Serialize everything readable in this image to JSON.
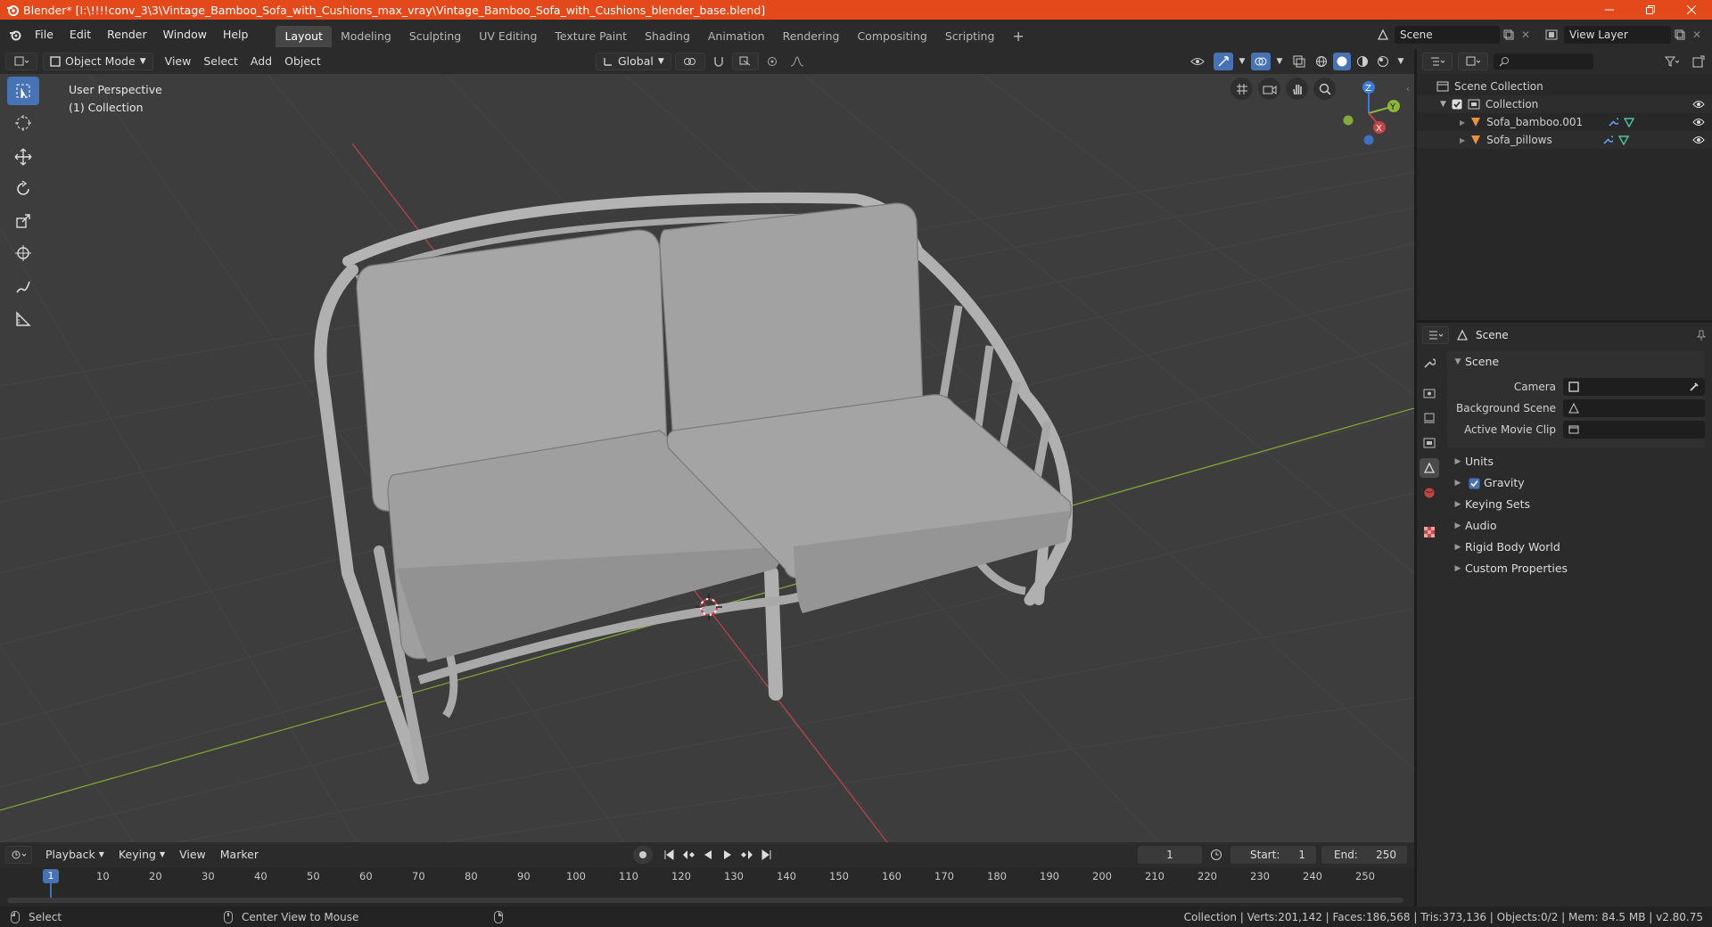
{
  "window": {
    "title": "Blender* [I:\\!!!!conv_3\\3\\Vintage_Bamboo_Sofa_with_Cushions_max_vray\\Vintage_Bamboo_Sofa_with_Cushions_blender_base.blend]"
  },
  "menus": [
    "File",
    "Edit",
    "Render",
    "Window",
    "Help"
  ],
  "workspaces": [
    "Layout",
    "Modeling",
    "Sculpting",
    "UV Editing",
    "Texture Paint",
    "Shading",
    "Animation",
    "Rendering",
    "Compositing",
    "Scripting"
  ],
  "active_workspace": "Layout",
  "scene_field": "Scene",
  "view_layer_field": "View Layer",
  "viewport_header": {
    "mode": "Object Mode",
    "menus": [
      "View",
      "Select",
      "Add",
      "Object"
    ],
    "orientation": "Global"
  },
  "viewport": {
    "perspective": "User Perspective",
    "collection": "(1) Collection",
    "gizmo": {
      "x": "X",
      "y": "Y",
      "z": "Z"
    }
  },
  "outliner": {
    "root": "Scene Collection",
    "collection": "Collection",
    "objects": [
      "Sofa_bamboo.001",
      "Sofa_pillows"
    ]
  },
  "properties": {
    "context": "Scene",
    "section": "Scene",
    "fields": [
      "Camera",
      "Background Scene",
      "Active Movie Clip"
    ],
    "subpanels": [
      "Units",
      "Gravity",
      "Keying Sets",
      "Audio",
      "Rigid Body World",
      "Custom Properties"
    ]
  },
  "timeline": {
    "menus": [
      "Playback",
      "Keying",
      "View",
      "Marker"
    ],
    "current_frame": "1",
    "start_label": "Start:",
    "start": "1",
    "end_label": "End:",
    "end": "250",
    "ruler": [
      "1",
      "10",
      "20",
      "30",
      "40",
      "50",
      "60",
      "70",
      "80",
      "90",
      "100",
      "110",
      "120",
      "130",
      "140",
      "150",
      "160",
      "170",
      "180",
      "190",
      "200",
      "210",
      "220",
      "230",
      "240",
      "250"
    ]
  },
  "statusbar": {
    "select": "Select",
    "center": "Center View to Mouse",
    "stats": "Collection | Verts:201,142 | Faces:186,568 | Tris:373,136 | Objects:0/2 | Mem: 84.5 MB | v2.80.75"
  },
  "colors": {
    "titlebar": "#e3491a",
    "active": "#4772b3",
    "axis_x": "#c8424a",
    "axis_y": "#8bb63a",
    "axis_z": "#3e7ad6"
  }
}
